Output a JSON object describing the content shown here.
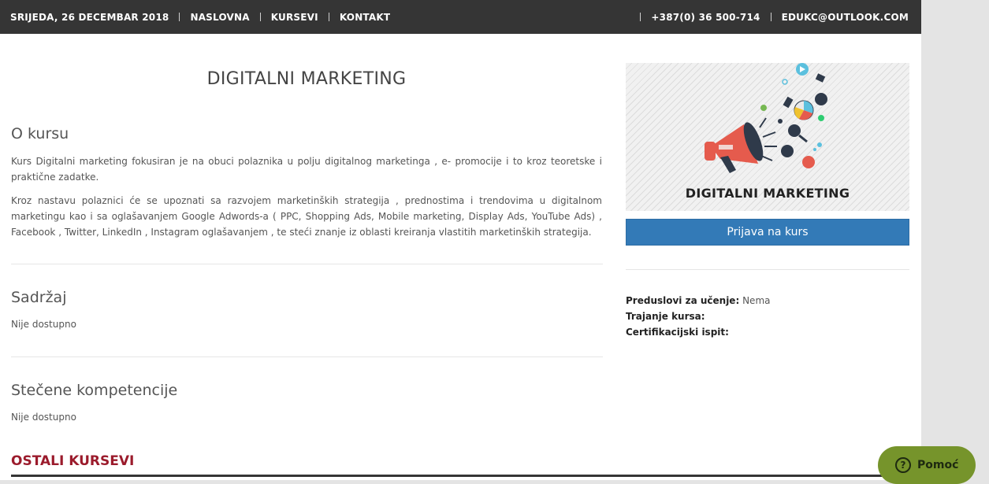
{
  "topbar": {
    "date": "SRIJEDA, 26 DECEMBAR 2018",
    "nav": [
      "NASLOVNA",
      "KURSEVI",
      "KONTAKT"
    ],
    "phone": "+387(0) 36 500-714",
    "email": "EDUKC@OUTLOOK.COM"
  },
  "course": {
    "title": "DIGITALNI MARKETING",
    "about_heading": "O kursu",
    "about_p1": "Kurs Digitalni marketing fokusiran je na obuci polaznika u polju digitalnog marketinga , e- promocije i to kroz teoretske i praktične zadatke.",
    "about_p2": "Kroz nastavu polaznici će se upoznati sa razvojem marketinških strategija , prednostima i trendovima u digitalnom marketingu kao i sa oglašavanjem Google Adwords-a ( PPC, Shopping Ads, Mobile marketing, Display Ads, YouTube Ads) , Facebook , Twitter, LinkedIn , Instagram oglašavanjem , te steći znanje iz oblasti kreiranja vlastitih marketinških strategija.",
    "content_heading": "Sadržaj",
    "content_value": "Nije dostupno",
    "competencies_heading": "Stečene kompetencije",
    "competencies_value": "Nije dostupno",
    "other_heading": "OSTALI KURSEVI"
  },
  "sidebar": {
    "image_caption": "DIGITALNI MARKETING",
    "enroll_button": "Prijava na kurs",
    "prereq_label": "Preduslovi za učenje:",
    "prereq_value": "Nema",
    "duration_label": "Trajanje kursa:",
    "duration_value": "",
    "exam_label": "Certifikacijski ispit:",
    "exam_value": ""
  },
  "help": {
    "label": "Pomoć",
    "icon": "question-icon"
  },
  "colors": {
    "topbar": "#353535",
    "accent_button": "#337ab7",
    "section_red": "#9b1b2c",
    "help_green": "#76942b"
  }
}
